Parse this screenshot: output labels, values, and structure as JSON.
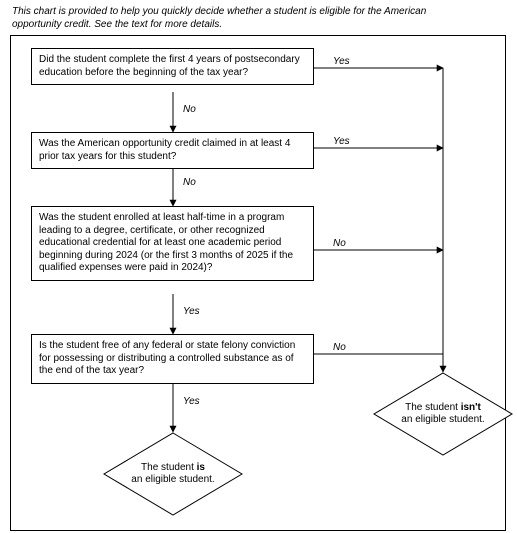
{
  "intro": "This chart is provided to help you quickly decide whether a student is eligible for the American opportunity credit. See the text for more details.",
  "q1": "Did the student complete the first 4 years of postsecondary education before the beginning of the tax year?",
  "q2": "Was the American opportunity credit claimed in at least 4 prior tax years for this student?",
  "q3": "Was the student enrolled at least half-time in a program leading to a degree, certificate, or other recognized educational credential for at least one academic period beginning during 2024 (or the first 3 months of 2025 if the qualified expenses were paid in 2024)?",
  "q4": "Is the student free of any federal or state felony conviction for possessing or distributing a controlled substance as of the end of the tax year?",
  "labels": {
    "yes": "Yes",
    "no": "No"
  },
  "result_is_pre": "The student ",
  "result_is_bold": "is",
  "result_is_post": " an eligible student.",
  "result_isnt_pre": "The student ",
  "result_isnt_bold": "isn't",
  "result_isnt_post": " an eligible student."
}
